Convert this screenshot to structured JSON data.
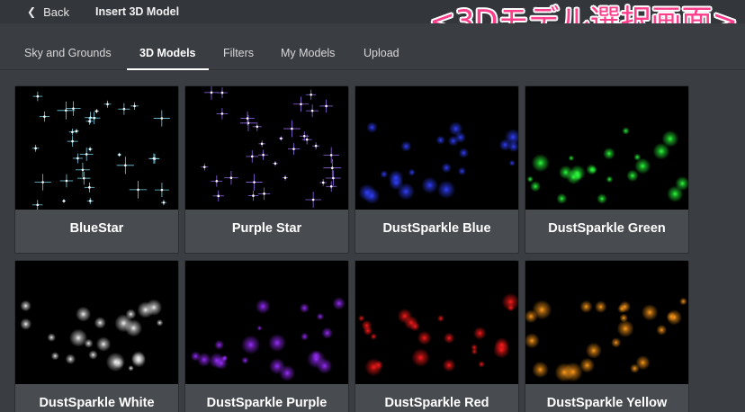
{
  "header": {
    "back_label": "Back",
    "title": "Insert 3D Model",
    "overlay_caption": "<3Dモデル選択画面>"
  },
  "tabs": [
    {
      "label": "Sky and Grounds",
      "active": false
    },
    {
      "label": "3D Models",
      "active": true
    },
    {
      "label": "Filters",
      "active": false
    },
    {
      "label": "My Models",
      "active": false
    },
    {
      "label": "Upload",
      "active": false
    }
  ],
  "models": [
    {
      "name": "BlueStar",
      "color": "#7fe6ff",
      "style": "star"
    },
    {
      "name": "Purple Star",
      "color": "#a070ff",
      "style": "star"
    },
    {
      "name": "DustSparkle Blue",
      "color": "#3040ff",
      "style": "dust"
    },
    {
      "name": "DustSparkle Green",
      "color": "#2aff3a",
      "style": "dust"
    },
    {
      "name": "DustSparkle White",
      "color": "#f0f0f0",
      "style": "dust"
    },
    {
      "name": "DustSparkle Purple",
      "color": "#9a2cff",
      "style": "dust"
    },
    {
      "name": "DustSparkle Red",
      "color": "#ff1a1a",
      "style": "dust"
    },
    {
      "name": "DustSparkle Yellow",
      "color": "#ff9a1a",
      "style": "dust"
    }
  ]
}
